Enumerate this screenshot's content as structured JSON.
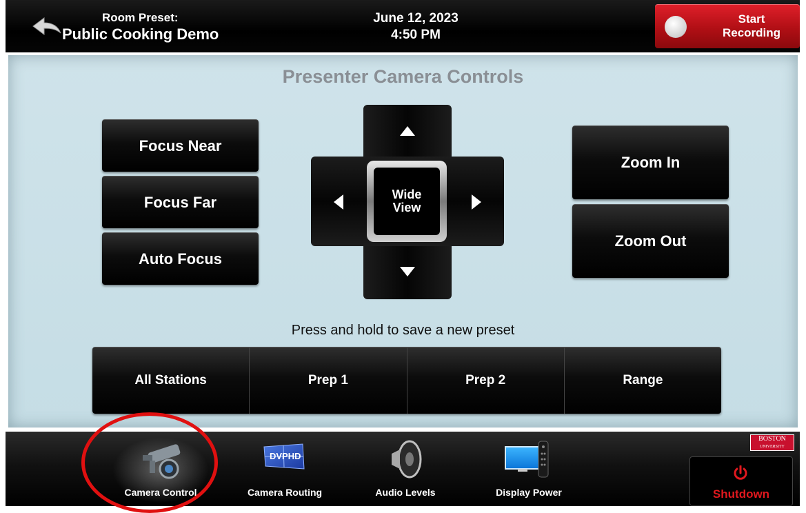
{
  "header": {
    "preset_label": "Room Preset:",
    "preset_name": "Public Cooking Demo",
    "date": "June 12, 2023",
    "time": "4:50 PM",
    "record_line1": "Start",
    "record_line2": "Recording",
    "back_icon": "back-arrow-icon"
  },
  "panel": {
    "title": "Presenter Camera Controls",
    "focus_buttons": [
      "Focus Near",
      "Focus Far",
      "Auto Focus"
    ],
    "zoom_buttons": [
      "Zoom In",
      "Zoom Out"
    ],
    "wide_line1": "Wide",
    "wide_line2": "View",
    "hint": "Press and hold to save a new preset",
    "presets": [
      "All Stations",
      "Prep 1",
      "Prep 2",
      "Range"
    ]
  },
  "nav": {
    "items": [
      {
        "label": "Camera Control",
        "icon": "camera-icon",
        "active": true
      },
      {
        "label": "Camera Routing",
        "icon": "routing-screen-icon",
        "active": false
      },
      {
        "label": "Audio Levels",
        "icon": "speaker-icon",
        "active": false
      },
      {
        "label": "Display Power",
        "icon": "display-remote-icon",
        "active": false
      }
    ],
    "logo_line1": "BOSTON",
    "logo_line2": "UNIVERSITY",
    "shutdown_label": "Shutdown",
    "routing_icon_text": "DVPHD"
  },
  "colors": {
    "accent_red": "#e0181e",
    "record_red": "#b10f15",
    "panel_bg": "#c9dfe7",
    "title_gray": "#8a8f95"
  }
}
